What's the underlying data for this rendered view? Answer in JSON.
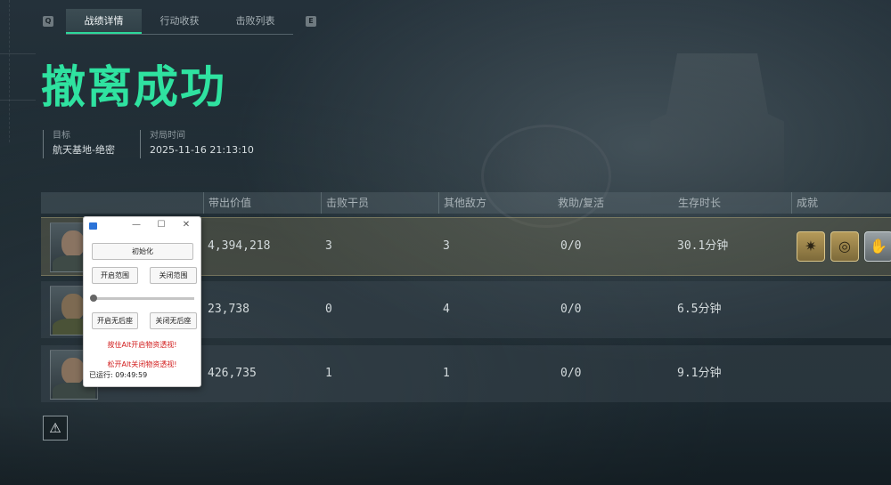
{
  "tabs": {
    "key_left": "Q",
    "key_right": "E",
    "items": [
      "战绩详情",
      "行动收获",
      "击败列表"
    ],
    "active": 0
  },
  "result_title": "撤离成功",
  "meta": {
    "target_label": "目标",
    "target_value": "航天基地-绝密",
    "time_label": "对局时间",
    "time_value": "2025-11-16 21:13:10"
  },
  "table": {
    "headers": [
      "带出价值",
      "击败干员",
      "其他敌方",
      "救助/复活",
      "生存时长",
      "成就"
    ],
    "rows": [
      {
        "value": "4,394,218",
        "kills": "3",
        "others": "3",
        "rescue": "0/0",
        "survival": "30.1分钟",
        "badges": [
          "sun-badge",
          "coin-badge",
          "hand-badge"
        ]
      },
      {
        "value": "23,738",
        "kills": "0",
        "others": "4",
        "rescue": "0/0",
        "survival": "6.5分钟",
        "badges": []
      },
      {
        "value": "426,735",
        "kills": "1",
        "others": "1",
        "rescue": "0/0",
        "survival": "9.1分钟",
        "badges": []
      }
    ]
  },
  "overlay": {
    "init_button": "初始化",
    "open_range": "开启范围",
    "close_range": "关闭范围",
    "open_norecoil": "开启无后座",
    "close_norecoil": "关闭无后座",
    "hint_open": "按住Alt开启物资透视!",
    "hint_close": "松开Alt关闭物资透视!",
    "status": "已运行: 09:49:59",
    "minimize": "—",
    "maximize": "☐",
    "close": "✕"
  },
  "colors": {
    "accent": "#2fe2a0",
    "highlight_row": "#7a735a",
    "warning_text": "#d11a1a"
  }
}
